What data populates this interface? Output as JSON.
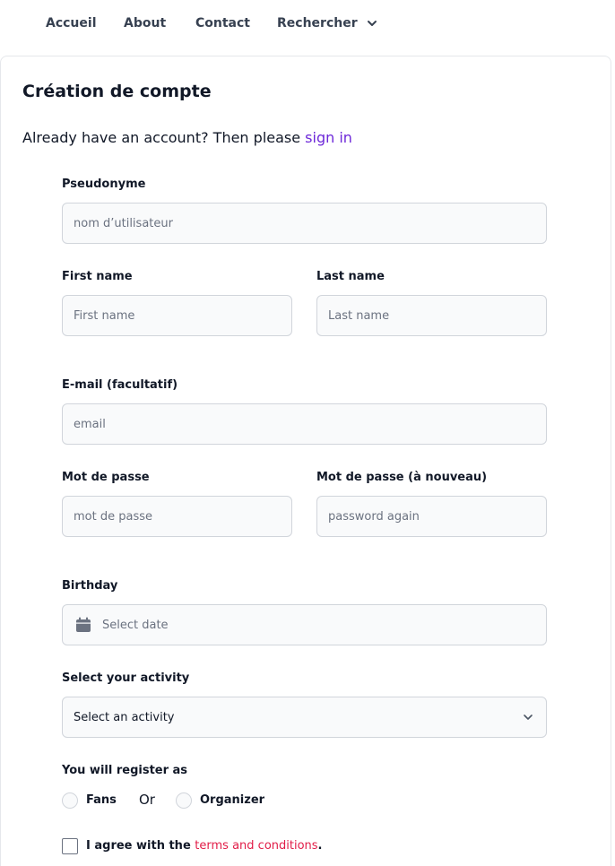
{
  "nav": {
    "items": [
      "Accueil",
      "About",
      "Contact",
      "Rechercher"
    ]
  },
  "form": {
    "title": "Création de compte",
    "subtitle_text": "Already have an account? Then please ",
    "signin_link": "sign in",
    "username": {
      "label": "Pseudonyme",
      "placeholder": "nom d’utilisateur"
    },
    "first_name": {
      "label": "First name",
      "placeholder": "First name"
    },
    "last_name": {
      "label": "Last name",
      "placeholder": "Last name"
    },
    "email": {
      "label": "E-mail (facultatif)",
      "placeholder": "email"
    },
    "password": {
      "label": "Mot de passe",
      "placeholder": "mot de passe"
    },
    "password_again": {
      "label": "Mot de passe (à nouveau)",
      "placeholder": "password again"
    },
    "birthday": {
      "label": "Birthday",
      "placeholder": "Select date"
    },
    "activity": {
      "label": "Select your activity",
      "selected": "Select an activity"
    },
    "register_as": {
      "label": "You will register as",
      "option_fans": "Fans",
      "or_text": "Or",
      "option_organizer": "Organizer"
    },
    "terms": {
      "text": "I agree with the ",
      "link": "terms and conditions",
      "suffix": "."
    }
  }
}
